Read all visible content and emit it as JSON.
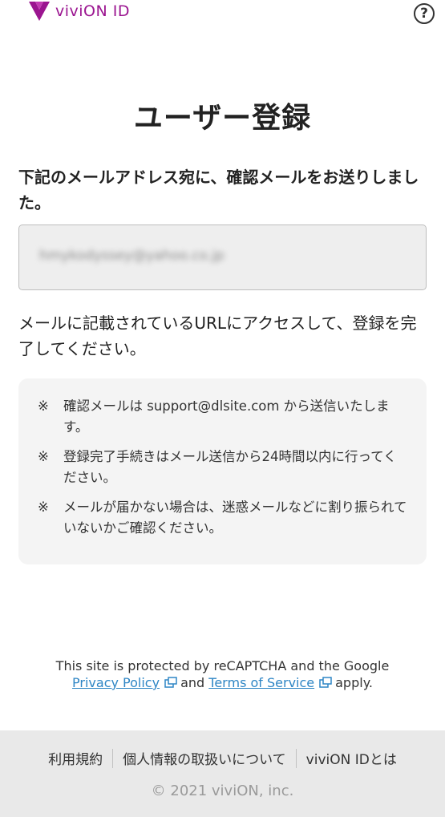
{
  "header": {
    "logo_text": "viviON ID",
    "help_symbol": "?",
    "brand_color": "#9b1590"
  },
  "page": {
    "title": "ユーザー登録",
    "lead": "下記のメールアドレス宛に、確認メールをお送りしました。",
    "email_value": "hmykodyssey@yahoo.co.jp",
    "instruction": "メールに記載されているURLにアクセスして、登録を完了してください。"
  },
  "notes": [
    {
      "mark": "※",
      "text": "確認メールは support@dlsite.com から送信いたします。"
    },
    {
      "mark": "※",
      "text": "登録完了手続きはメール送信から24時間以内に行ってください。"
    },
    {
      "mark": "※",
      "text": "メールが届かない場合は、迷惑メールなどに割り振られていないかご確認ください。"
    }
  ],
  "recaptcha": {
    "line1": "This site is protected by reCAPTCHA and the Google",
    "privacy_link": "Privacy Policy",
    "and_text": "and",
    "terms_link": "Terms of Service",
    "apply_text": "apply.",
    "link_color": "#2f86c5"
  },
  "footer": {
    "links": [
      "利用規約",
      "個人情報の取扱いについて",
      "viviON IDとは"
    ],
    "copyright": "© 2021 viviON, inc."
  }
}
